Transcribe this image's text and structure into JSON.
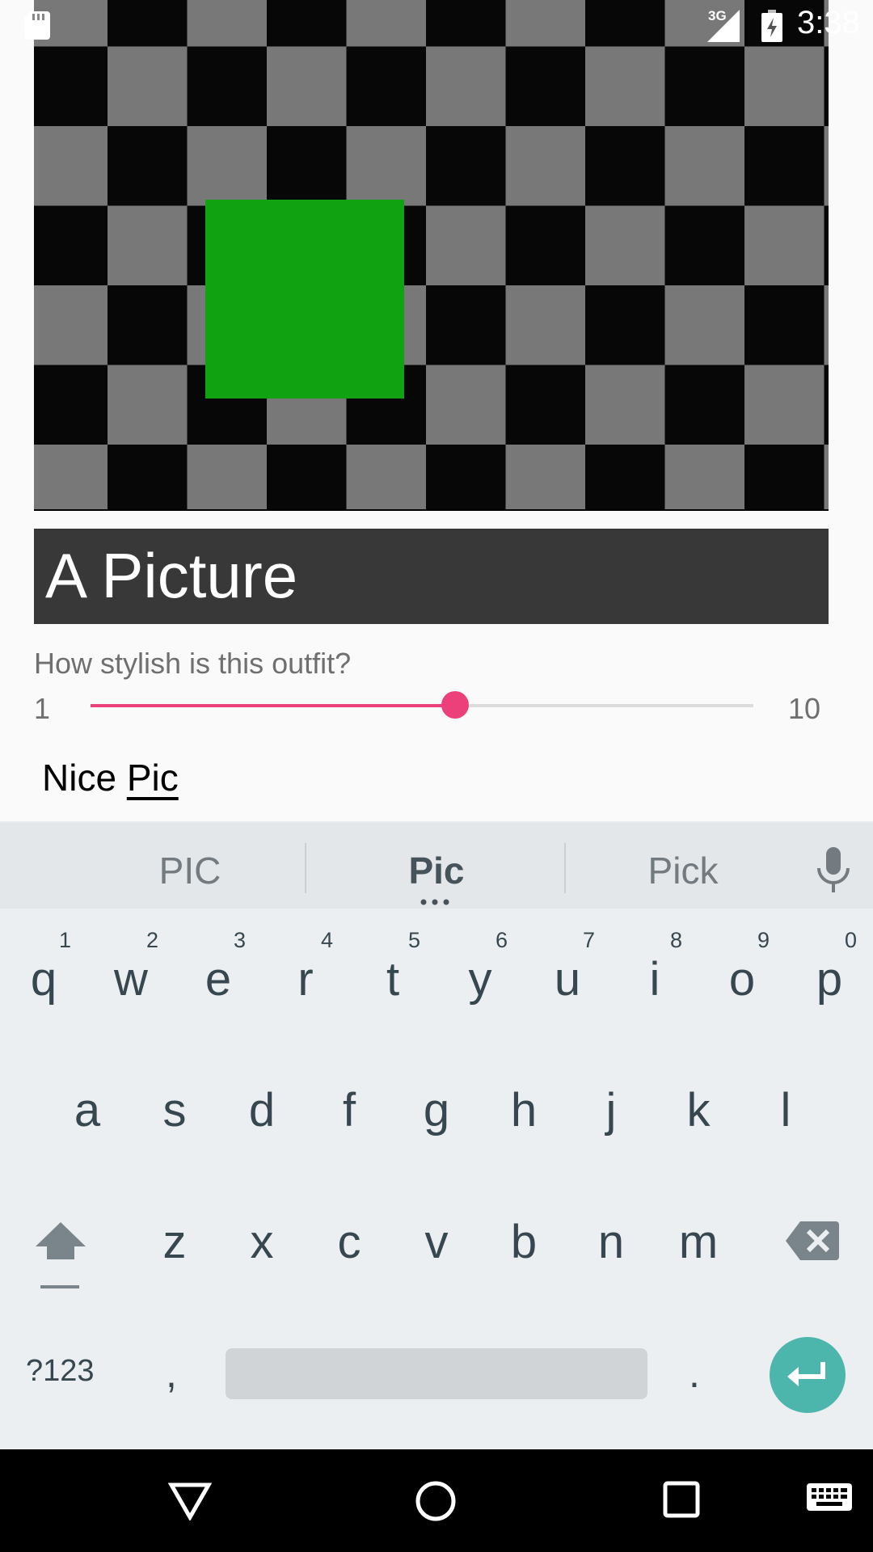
{
  "status_bar": {
    "network_type": "3G",
    "time": "3:38",
    "icons": [
      "sd-card-icon",
      "signal-icon",
      "battery-charging-icon"
    ]
  },
  "picture": {
    "caption": "A Picture",
    "colors": {
      "light_square": "#787878",
      "dark_square": "#070707",
      "green_square": "#10a210",
      "caption_bg": "#383838"
    }
  },
  "rating": {
    "question": "How stylish is this outfit?",
    "min_label": "1",
    "max_label": "10",
    "value_fraction": 0.55,
    "accent_color": "#ec407a"
  },
  "comment": {
    "text_before": "Nice ",
    "composing_word": "Pic"
  },
  "keyboard": {
    "suggestions": [
      "PIC",
      "Pic",
      "Pick"
    ],
    "row1": [
      {
        "char": "q",
        "hint": "1"
      },
      {
        "char": "w",
        "hint": "2"
      },
      {
        "char": "e",
        "hint": "3"
      },
      {
        "char": "r",
        "hint": "4"
      },
      {
        "char": "t",
        "hint": "5"
      },
      {
        "char": "y",
        "hint": "6"
      },
      {
        "char": "u",
        "hint": "7"
      },
      {
        "char": "i",
        "hint": "8"
      },
      {
        "char": "o",
        "hint": "9"
      },
      {
        "char": "p",
        "hint": "0"
      }
    ],
    "row2": [
      "a",
      "s",
      "d",
      "f",
      "g",
      "h",
      "j",
      "k",
      "l"
    ],
    "row3": [
      "z",
      "x",
      "c",
      "v",
      "b",
      "n",
      "m"
    ],
    "symbols_label": "?123",
    "comma_label": ",",
    "period_label": ".",
    "enter_color": "#4db6ac"
  },
  "nav_bar": {
    "icons": [
      "back-icon",
      "home-icon",
      "recents-icon",
      "keyboard-switch-icon"
    ]
  }
}
